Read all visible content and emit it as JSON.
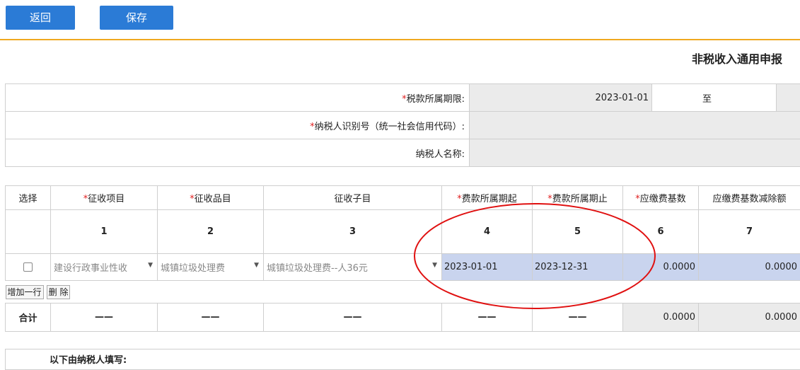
{
  "toolbar": {
    "back_label": "返回",
    "save_label": "保存"
  },
  "title": "非税收入通用申报",
  "header_form": {
    "period_label": "税款所属期限:",
    "period_start": "2023-01-01",
    "period_to": "至",
    "taxpayer_id_label": "纳税人识别号（统一社会信用代码）:",
    "taxpayer_name_label": "纳税人名称:"
  },
  "table": {
    "columns": [
      "选择",
      "征收项目",
      "征收品目",
      "征收子目",
      "费款所属期起",
      "费款所属期止",
      "应缴费基数",
      "应缴费基数减除额"
    ],
    "required": [
      false,
      true,
      true,
      false,
      true,
      true,
      true,
      false
    ],
    "numbers": [
      "1",
      "2",
      "3",
      "4",
      "5",
      "6",
      "7"
    ],
    "row": {
      "item": "建设行政事业性收",
      "category": "城镇垃圾处理费",
      "subitem": "城镇垃圾处理费--人36元",
      "start": "2023-01-01",
      "end": "2023-12-31",
      "base": "0.0000",
      "deduction": "0.0000"
    },
    "add_row_label": "增加一行",
    "delete_label": "删 除",
    "total": {
      "label": "合计",
      "dash": "——",
      "base": "0.0000",
      "deduction": "0.0000"
    }
  },
  "bottom_note": "以下由纳税人填写:",
  "colors": {
    "accent": "#2b7bd6",
    "divider": "#f0a81f",
    "highlight": "#c9d4ee",
    "annotation": "#e01010"
  }
}
